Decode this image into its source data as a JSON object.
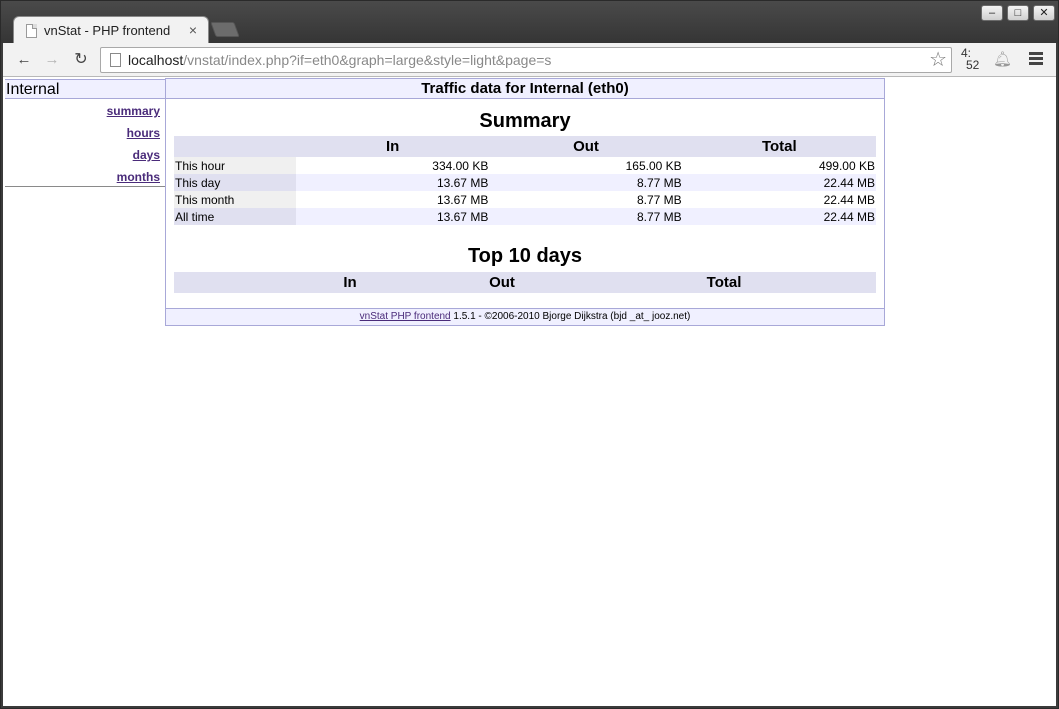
{
  "browser": {
    "tab_title": "vnStat - PHP frontend",
    "tab_close": "×",
    "url_host": "localhost",
    "url_path": "/vnstat/index.php?if=eth0&graph=large&style=light&page=s",
    "clock_hour": "4:",
    "clock_min": "52",
    "window_min": "–",
    "window_max": "□",
    "window_close": "✕"
  },
  "sidebar": {
    "interface_name": "Internal",
    "items": [
      {
        "label": "summary"
      },
      {
        "label": "hours"
      },
      {
        "label": "days"
      },
      {
        "label": "months"
      }
    ]
  },
  "content": {
    "header": "Traffic data for Internal (eth0)",
    "summary_title": "Summary",
    "summary_columns": [
      "",
      "In",
      "Out",
      "Total"
    ],
    "summary_rows": [
      {
        "label": "This hour",
        "in": "334.00 KB",
        "out": "165.00 KB",
        "total": "499.00 KB"
      },
      {
        "label": "This day",
        "in": "13.67 MB",
        "out": "8.77 MB",
        "total": "22.44 MB"
      },
      {
        "label": "This month",
        "in": "13.67 MB",
        "out": "8.77 MB",
        "total": "22.44 MB"
      },
      {
        "label": "All time",
        "in": "13.67 MB",
        "out": "8.77 MB",
        "total": "22.44 MB"
      }
    ],
    "top10_title": "Top 10 days",
    "top10_columns": [
      "",
      "In",
      "Out",
      "Total"
    ]
  },
  "footer": {
    "link_text": "vnStat PHP frontend",
    "text": " 1.5.1 - ©2006-2010 Bjorge Dijkstra (bjd _at_ jooz.net)"
  }
}
